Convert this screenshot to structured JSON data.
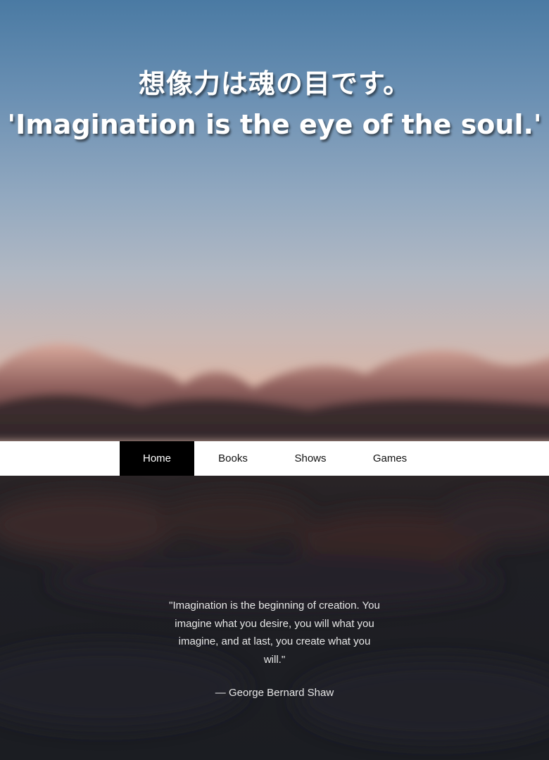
{
  "hero": {
    "title_jp": "想像力は魂の目です。",
    "title_en": "'Imagination is the eye of the soul.'"
  },
  "nav": {
    "items": [
      {
        "label": "Home",
        "active": true
      },
      {
        "label": "Books",
        "active": false
      },
      {
        "label": "Shows",
        "active": false
      },
      {
        "label": "Games",
        "active": false
      }
    ]
  },
  "quote": {
    "text": "\"Imagination is the beginning of creation. You imagine what you desire, you will what you imagine, and at last, you create what you will.\"",
    "author": "— George Bernard Shaw"
  },
  "colors": {
    "sky_top": "#4a7aa3",
    "sky_horizon": "#d8b7a9",
    "nav_active_bg": "#000000",
    "lower_bg": "#1b1d22"
  }
}
